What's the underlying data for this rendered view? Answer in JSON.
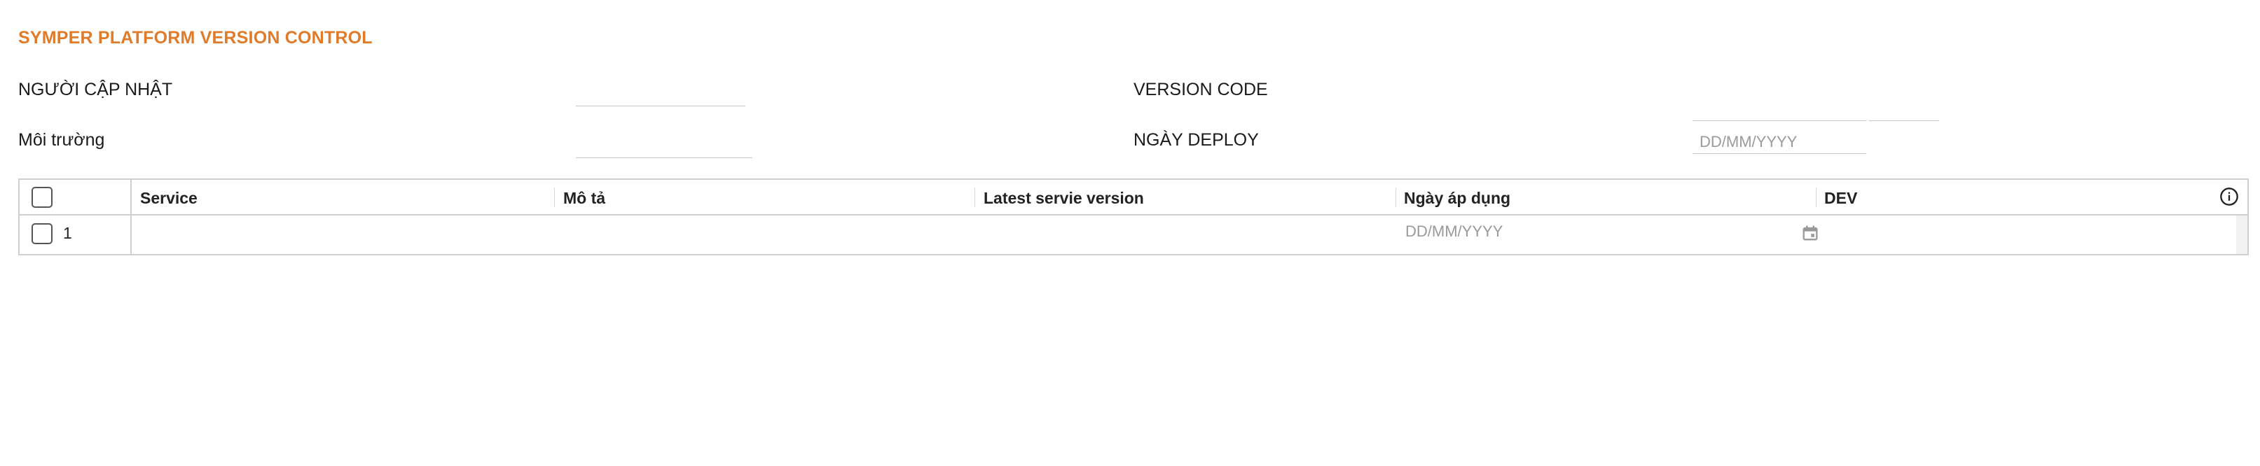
{
  "header": {
    "title": "SYMPER PLATFORM VERSION CONTROL"
  },
  "form": {
    "updater_label": "NGƯỜI CẬP NHẬT",
    "updater_value": "",
    "environment_label": "Môi trường",
    "environment_value": "",
    "version_code_label": "VERSION CODE",
    "version_code_value": "",
    "version_code_suffix_value": "",
    "deploy_date_label": "NGÀY DEPLOY",
    "deploy_date_placeholder": "DD/MM/YYYY"
  },
  "table": {
    "columns": [
      "Service",
      "Mô tả",
      "Latest servie version",
      "Ngày áp dụng",
      "DEV"
    ],
    "rows": [
      {
        "index": "1",
        "service": "",
        "description": "",
        "latest_version": "",
        "apply_date_placeholder": "DD/MM/YYYY",
        "dev": ""
      }
    ]
  },
  "icons": {
    "info": "info-icon",
    "calendar": "calendar-icon"
  },
  "colors": {
    "title": "#e07b2a",
    "border": "#cfcfcf",
    "placeholder": "#9a9a9a"
  }
}
